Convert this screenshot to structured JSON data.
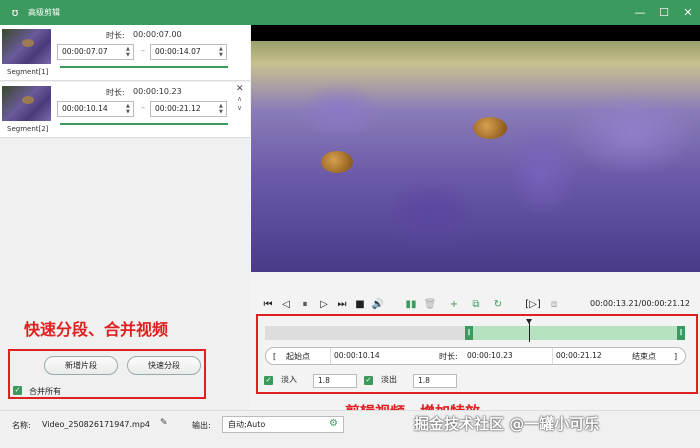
{
  "window": {
    "title": "高级剪辑",
    "min": "—",
    "max": "☐",
    "close": "✕"
  },
  "segments": [
    {
      "label": "Segment[1]",
      "duration_label": "时长:",
      "duration": "00:00:07.00",
      "start": "00:00:07.07",
      "end": "00:00:14.07",
      "separator": "–"
    },
    {
      "label": "Segment[2]",
      "duration_label": "时长:",
      "duration": "00:00:10.23",
      "start": "00:00:10.14",
      "end": "00:00:21.12",
      "separator": "–",
      "close": "✕",
      "up": "∧",
      "down": "∨"
    }
  ],
  "annotations": {
    "left": "快速分段、合并视频",
    "right": "剪辑视频、增加特效"
  },
  "buttons": {
    "add_segment": "新增片段",
    "quick_split": "快速分段"
  },
  "merge_all": {
    "label": "合并所有",
    "checked": true
  },
  "controls": {
    "time_readout": "00:00:13.21/00:00:21.12"
  },
  "range": {
    "start_bracket": "[",
    "start_label": "起始点",
    "start_value": "00:00:10.14",
    "duration_label": "时长:",
    "duration_value": "00:00:10.23",
    "end_value": "00:00:21.12",
    "end_label": "结束点",
    "end_bracket": "]"
  },
  "fade": {
    "fade_in_label": "淡入",
    "fade_in_value": "1.8",
    "fade_out_label": "淡出",
    "fade_out_value": "1.8"
  },
  "bottom": {
    "name_label": "名称:",
    "name_value": "Video_250826171947.mp4",
    "output_label": "输出:",
    "output_value": "自动;Auto"
  },
  "watermark": "掘金技术社区 @一罐小可乐",
  "colors": {
    "accent": "#3c9a5f",
    "annotation": "#e02020"
  }
}
